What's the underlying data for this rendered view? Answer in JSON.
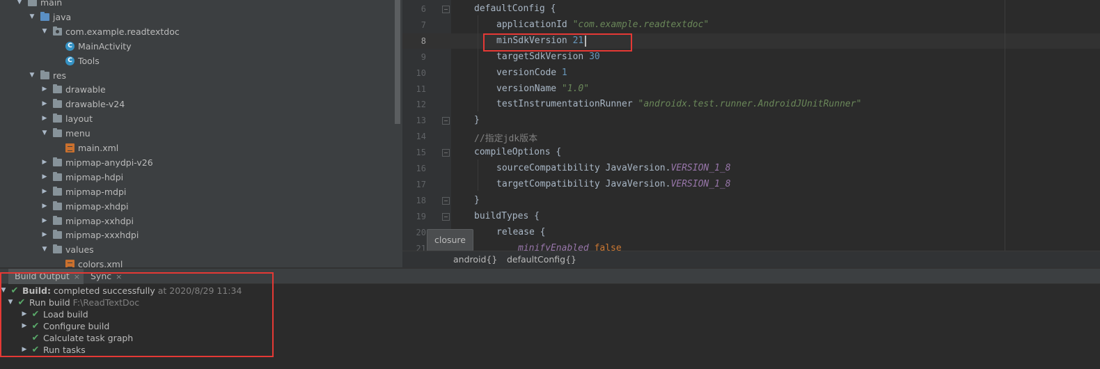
{
  "project_tree": {
    "items": [
      {
        "label": "main",
        "icon": "folder-icon",
        "expanded": true
      },
      {
        "label": "java",
        "icon": "folder-blue-icon",
        "expanded": true
      },
      {
        "label": "com.example.readtextdoc",
        "icon": "package-icon",
        "expanded": true
      },
      {
        "label": "MainActivity",
        "icon": "class-icon"
      },
      {
        "label": "Tools",
        "icon": "class-icon"
      },
      {
        "label": "res",
        "icon": "folder-res-icon",
        "expanded": true
      },
      {
        "label": "drawable",
        "icon": "folder-icon",
        "expanded": false
      },
      {
        "label": "drawable-v24",
        "icon": "folder-icon",
        "expanded": false
      },
      {
        "label": "layout",
        "icon": "folder-icon",
        "expanded": false
      },
      {
        "label": "menu",
        "icon": "folder-icon",
        "expanded": true
      },
      {
        "label": "main.xml",
        "icon": "xml-file-icon"
      },
      {
        "label": "mipmap-anydpi-v26",
        "icon": "folder-icon",
        "expanded": false
      },
      {
        "label": "mipmap-hdpi",
        "icon": "folder-icon",
        "expanded": false
      },
      {
        "label": "mipmap-mdpi",
        "icon": "folder-icon",
        "expanded": false
      },
      {
        "label": "mipmap-xhdpi",
        "icon": "folder-icon",
        "expanded": false
      },
      {
        "label": "mipmap-xxhdpi",
        "icon": "folder-icon",
        "expanded": false
      },
      {
        "label": "mipmap-xxxhdpi",
        "icon": "folder-icon",
        "expanded": false
      },
      {
        "label": "values",
        "icon": "folder-icon",
        "expanded": true
      },
      {
        "label": "colors.xml",
        "icon": "xml-file-icon"
      }
    ],
    "class_letter": "C"
  },
  "editor": {
    "lines": [
      {
        "num": "6",
        "parts": [
          [
            "plain",
            "defaultConfig {"
          ]
        ]
      },
      {
        "num": "7",
        "parts": [
          [
            "plain",
            "applicationId "
          ],
          [
            "str",
            "\"com.example.readtextdoc\""
          ]
        ]
      },
      {
        "num": "8",
        "parts": [
          [
            "plain",
            "minSdkVersion "
          ],
          [
            "num",
            "21"
          ]
        ]
      },
      {
        "num": "9",
        "parts": [
          [
            "plain",
            "targetSdkVersion "
          ],
          [
            "num",
            "30"
          ]
        ]
      },
      {
        "num": "10",
        "parts": [
          [
            "plain",
            "versionCode "
          ],
          [
            "num",
            "1"
          ]
        ]
      },
      {
        "num": "11",
        "parts": [
          [
            "plain",
            "versionName "
          ],
          [
            "str",
            "\"1.0\""
          ]
        ]
      },
      {
        "num": "12",
        "parts": [
          [
            "plain",
            "testInstrumentationRunner "
          ],
          [
            "str",
            "\"androidx.test.runner.AndroidJUnitRunner\""
          ]
        ]
      },
      {
        "num": "13",
        "parts": [
          [
            "plain",
            "}"
          ]
        ]
      },
      {
        "num": "14",
        "parts": [
          [
            "cmt",
            "//指定jdk版本"
          ]
        ]
      },
      {
        "num": "15",
        "parts": [
          [
            "plain",
            "compileOptions {"
          ]
        ]
      },
      {
        "num": "16",
        "parts": [
          [
            "plain",
            "sourceCompatibility JavaVersion."
          ],
          [
            "cnst",
            "VERSION_1_8"
          ]
        ]
      },
      {
        "num": "17",
        "parts": [
          [
            "plain",
            "targetCompatibility JavaVersion."
          ],
          [
            "cnst",
            "VERSION_1_8"
          ]
        ]
      },
      {
        "num": "18",
        "parts": [
          [
            "plain",
            "}"
          ]
        ]
      },
      {
        "num": "19",
        "parts": [
          [
            "plain",
            "buildTypes {"
          ]
        ]
      },
      {
        "num": "20",
        "parts": [
          [
            "plain",
            "release {"
          ]
        ]
      },
      {
        "num": "21",
        "parts": [
          [
            "cnst",
            "minifyEnabled "
          ],
          [
            "kw",
            "false"
          ]
        ]
      }
    ],
    "current_line": "8",
    "tooltip": "closure"
  },
  "breadcrumbs": [
    "android{}",
    "defaultConfig{}"
  ],
  "build_panel": {
    "tabs": [
      {
        "label": "Build Output",
        "close": "×"
      },
      {
        "label": "Sync",
        "close": "×"
      }
    ],
    "tree": [
      {
        "bold": "Build:",
        "text": " completed successfully",
        "muted": " at 2020/8/29 11:34"
      },
      {
        "text": "Run build",
        "muted": " F:\\ReadTextDoc"
      },
      {
        "text": "Load build"
      },
      {
        "text": "Configure build"
      },
      {
        "text": "Calculate task graph"
      },
      {
        "text": "Run tasks"
      }
    ]
  },
  "colors": {
    "highlight_box": "#e53935",
    "success": "#59a869"
  }
}
